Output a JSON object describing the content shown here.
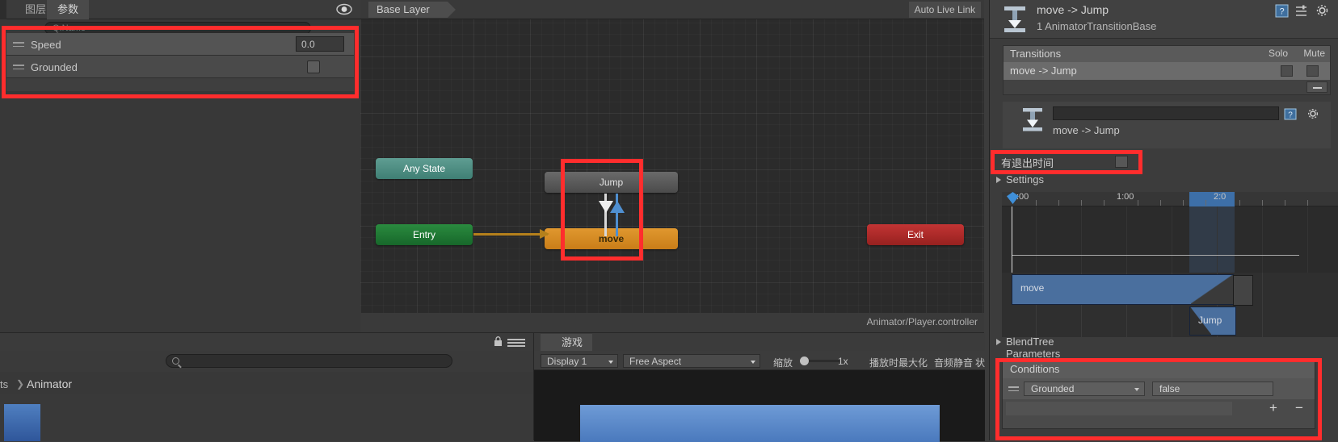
{
  "left_panel": {
    "tabs": [
      {
        "label": "图层",
        "selected": false
      },
      {
        "label": "参数",
        "selected": true
      }
    ],
    "search_placeholder": "Q:Name",
    "eye_icon": "eye-icon",
    "parameters": [
      {
        "name": "Speed",
        "type": "float",
        "value": "0.0"
      },
      {
        "name": "Grounded",
        "type": "bool",
        "value": "false"
      }
    ]
  },
  "graph": {
    "breadcrumb": "Base Layer",
    "live_link_label": "Auto Live Link",
    "status_path": "Animator/Player.controller",
    "nodes": [
      {
        "id": "anystate",
        "label": "Any State",
        "color": "#4f8c81"
      },
      {
        "id": "entry",
        "label": "Entry",
        "color": "#21803a"
      },
      {
        "id": "jump",
        "label": "Jump",
        "color": "#5a5a5a"
      },
      {
        "id": "move",
        "label": "move",
        "color": "#d58a23"
      },
      {
        "id": "exit",
        "label": "Exit",
        "color": "#ad2a28"
      }
    ]
  },
  "bottom_left": {
    "breadcrumb_root": "ts",
    "breadcrumb_sep": "❯",
    "breadcrumb_current": "Animator",
    "icons": [
      "lock-icon",
      "menu-icon",
      "search-icon",
      "filter-icon",
      "tag-icon",
      "star-icon"
    ]
  },
  "game_view": {
    "tab_label": "游戏",
    "display": "Display 1",
    "aspect": "Free Aspect",
    "scale_label": "缩放",
    "scale_value": "1x",
    "maximize_label": "播放时最大化",
    "mute_label": "音频静音",
    "stats_label": "状"
  },
  "inspector": {
    "title": "move -> Jump",
    "subtitle": "1 AnimatorTransitionBase",
    "header_icons": [
      "help-icon",
      "preset-icon",
      "gear-icon"
    ],
    "transitions": {
      "header": "Transitions",
      "solo_label": "Solo",
      "mute_label": "Mute",
      "rows": [
        {
          "label": "move -> Jump",
          "solo": false,
          "mute": false
        }
      ]
    },
    "detail": {
      "field_value": "",
      "name": "move -> Jump"
    },
    "has_exit_time": {
      "label": "有退出时间",
      "checked": false
    },
    "settings_label": "Settings",
    "blendtree_label": "BlendTree Parameters",
    "timeline": {
      "ticks": [
        ":00",
        "1:00",
        "2:0"
      ],
      "clips": [
        {
          "label": "move"
        },
        {
          "label": "Jump"
        }
      ]
    },
    "conditions": {
      "header": "Conditions",
      "rows": [
        {
          "parameter": "Grounded",
          "value": "false"
        }
      ],
      "add_label": "+",
      "remove_label": "−"
    }
  }
}
